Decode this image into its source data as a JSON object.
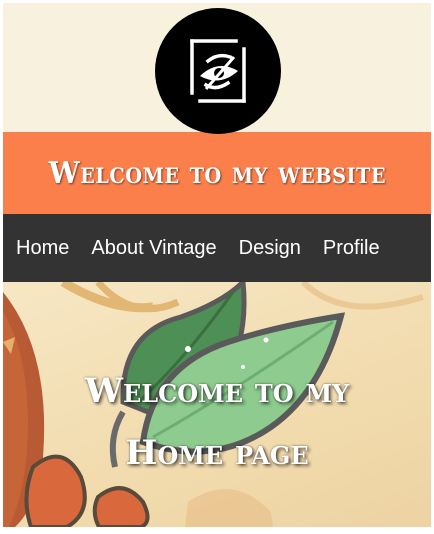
{
  "header": {
    "logo_icon": "compass-eye-logo-icon",
    "title": "Welcome to my website"
  },
  "nav": {
    "items": [
      {
        "label": "Home"
      },
      {
        "label": "About Vintage"
      },
      {
        "label": "Design"
      },
      {
        "label": "Profile"
      }
    ]
  },
  "hero": {
    "title": "Welcome to my Home page"
  },
  "colors": {
    "page_background": "#f7efdd",
    "banner": "#fb7f4b",
    "navbar": "#333333",
    "logo_circle": "#000000",
    "text_light": "#ffffff"
  }
}
